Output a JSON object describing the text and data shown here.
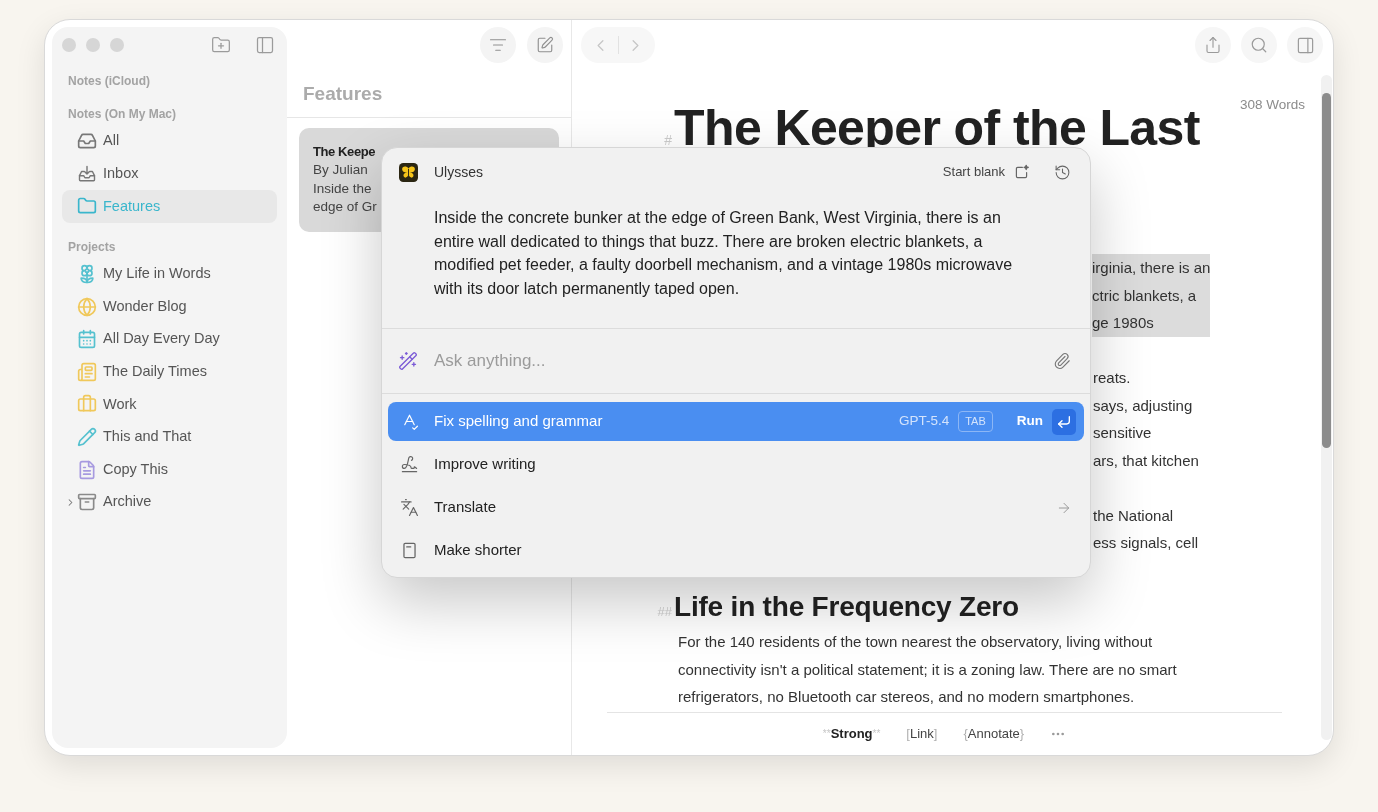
{
  "sidebar": {
    "sections": [
      {
        "title": "Notes (iCloud)"
      },
      {
        "title": "Notes (On My Mac)",
        "items": [
          {
            "label": "All",
            "selected": false
          },
          {
            "label": "Inbox",
            "selected": false
          },
          {
            "label": "Features",
            "selected": true
          }
        ]
      },
      {
        "title": "Projects",
        "items": [
          {
            "label": "My Life in Words",
            "selected": false,
            "color": "#55c1cf"
          },
          {
            "label": "Wonder Blog",
            "selected": false,
            "color": "#f0c85a"
          },
          {
            "label": "All Day Every Day",
            "selected": false,
            "color": "#55c1cf"
          },
          {
            "label": "The Daily Times",
            "selected": false,
            "color": "#f0c85a"
          },
          {
            "label": "Work",
            "selected": false,
            "color": "#f0c85a"
          },
          {
            "label": "This and That",
            "selected": false,
            "color": "#55c1cf"
          },
          {
            "label": "Copy This",
            "selected": false,
            "color": "#a79ae0"
          },
          {
            "label": "Archive",
            "selected": false,
            "color": "#8a8a8a",
            "expanded": false
          }
        ]
      }
    ]
  },
  "note_list": {
    "title": "Features",
    "notes": [
      {
        "title": "The Keepe",
        "lines": [
          "By Julian",
          "Inside the",
          "edge of Gr"
        ],
        "selected": true
      }
    ]
  },
  "editor": {
    "word_count": "308 Words",
    "heading": {
      "marker": "#",
      "text": "The Keeper of the Last"
    },
    "selection_lines": [
      "irginia, there is an",
      "ctric blankets, a",
      "ge 1980s"
    ],
    "paragraph_fragments": [
      {
        "lines": [
          "reats.",
          "says, adjusting",
          "sensitive",
          "ars, that kitchen"
        ]
      },
      {
        "lines": [
          "the National",
          "ess signals, cell"
        ]
      }
    ],
    "subheading": {
      "marker": "##",
      "text": "Life in the Frequency Zero"
    },
    "paragraph": "For the 140 residents of the town nearest the observatory, living without connectivity isn't a political statement; it is a zoning law. There are no smart refrigerators, no Bluetooth car stereos, and no modern smartphones.",
    "format_bar": [
      {
        "kind": "strong",
        "open": "**",
        "label": "Strong",
        "close": "**"
      },
      {
        "kind": "link",
        "open": "[",
        "label": "Link",
        "close": "]"
      },
      {
        "kind": "annotate",
        "open": "{",
        "label": "Annotate",
        "close": "}"
      }
    ]
  },
  "assistant": {
    "app_name": "Ulysses",
    "start_blank": "Start blank",
    "quote": "Inside the concrete bunker at the edge of Green Bank, West Virginia, there is an entire wall dedicated to things that buzz. There are broken electric blankets, a modified pet feeder, a faulty doorbell mechanism, and a vintage 1980s microwave with its door latch permanently taped open.",
    "prompt": {
      "placeholder": "Ask anything..."
    },
    "actions": [
      {
        "label": "Fix spelling and grammar",
        "selected": true,
        "submenu": false,
        "model": "GPT-5.4",
        "shortcut": "TAB",
        "run": "Run"
      },
      {
        "label": "Improve writing",
        "selected": false,
        "submenu": false
      },
      {
        "label": "Translate",
        "selected": false,
        "submenu": true
      },
      {
        "label": "Make shorter",
        "selected": false,
        "submenu": false
      }
    ]
  }
}
